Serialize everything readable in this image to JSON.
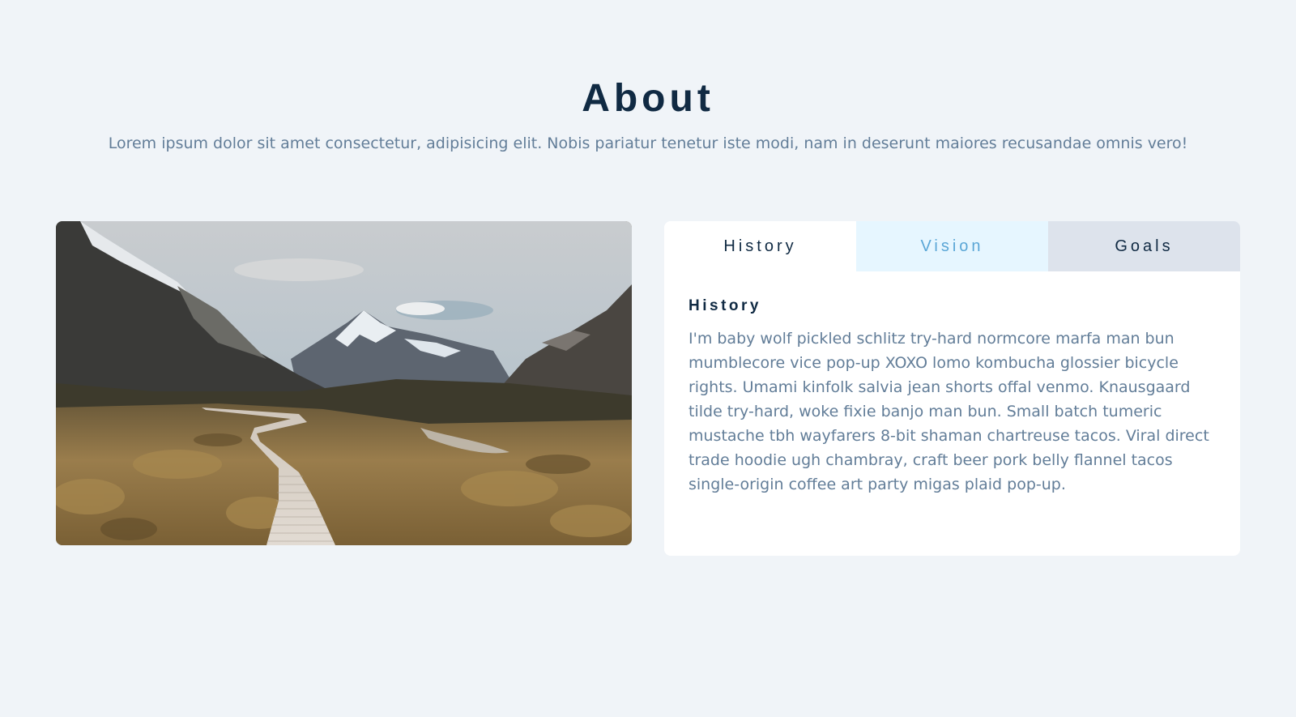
{
  "about": {
    "title": "About",
    "subtitle": "Lorem ipsum dolor sit amet consectetur, adipisicing elit. Nobis pariatur tenetur iste modi, nam in deserunt maiores recusandae omnis vero!"
  },
  "tabs": [
    {
      "label": "History",
      "active": true
    },
    {
      "label": "Vision",
      "active": false
    },
    {
      "label": "Goals",
      "active": false
    }
  ],
  "content": {
    "heading": "History",
    "text": "I'm baby wolf pickled schlitz try-hard normcore marfa man bun mumblecore vice pop-up XOXO lomo kombucha glossier bicycle rights. Umami kinfolk salvia jean shorts offal venmo. Knausgaard tilde try-hard, woke fixie banjo man bun. Small batch tumeric mustache tbh wayfarers 8-bit shaman chartreuse tacos. Viral direct trade hoodie ugh chambray, craft beer pork belly flannel tacos single-origin coffee art party migas plaid pop-up."
  },
  "colors": {
    "background": "#f0f4f8",
    "heading": "#102a43",
    "body_text": "#627d98",
    "tab_active_bg": "#ffffff",
    "tab_vision_bg": "#e6f6ff",
    "tab_vision_text": "#5aa6d6",
    "tab_goals_bg": "#dde3ec"
  }
}
